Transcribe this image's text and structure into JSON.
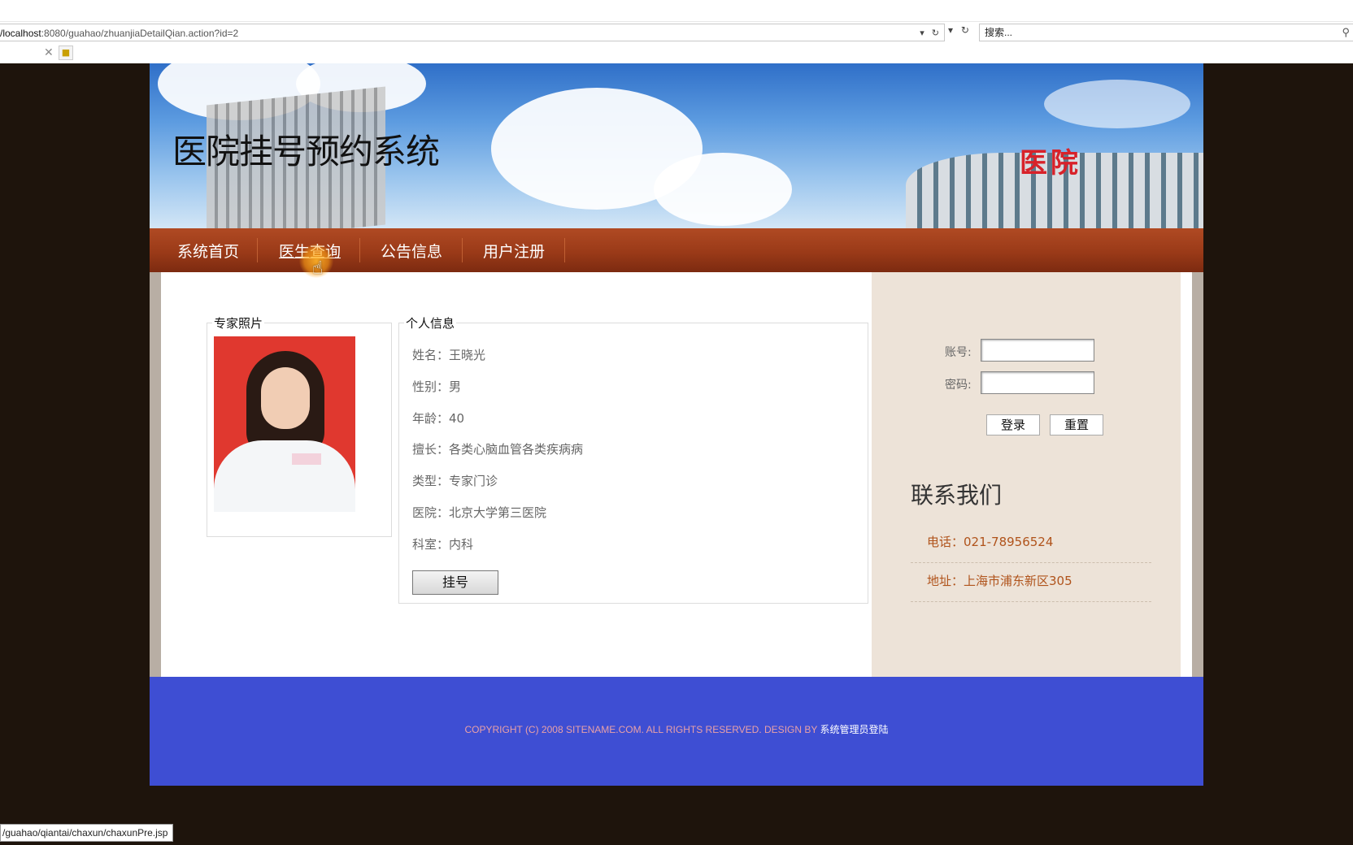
{
  "browser": {
    "address_host": "/localhost",
    "address_rest": ":8080/guahao/zhuanjiaDetailQian.action?id=2",
    "search_placeholder": "搜索...",
    "status_url": "/guahao/qiantai/chaxun/chaxunPre.jsp"
  },
  "site": {
    "title": "医院挂号预约系统",
    "banner_sign": "医院"
  },
  "nav": {
    "items": [
      "系统首页",
      "医生查询",
      "公告信息",
      "用户注册"
    ],
    "active": "医生查询"
  },
  "photo_box": {
    "legend": "专家照片"
  },
  "info_box": {
    "legend": "个人信息",
    "fields": [
      {
        "label": "姓名：",
        "value": "王晓光"
      },
      {
        "label": "性别：",
        "value": "男"
      },
      {
        "label": "年龄：",
        "value": "40"
      },
      {
        "label": "擅长：",
        "value": "各类心脑血管各类疾病病"
      },
      {
        "label": "类型：",
        "value": "专家门诊"
      },
      {
        "label": "医院：",
        "value": "北京大学第三医院"
      },
      {
        "label": "科室：",
        "value": "内科"
      }
    ],
    "register_button": "挂号"
  },
  "login": {
    "account_label": "账号:",
    "password_label": "密码:",
    "login_button": "登录",
    "reset_button": "重置"
  },
  "contact": {
    "title": "联系我们",
    "phone": "电话：021-78956524",
    "address": "地址：上海市浦东新区305"
  },
  "footer": {
    "copyright": "COPYRIGHT (C) 2008 SITENAME.COM. ALL RIGHTS RESERVED. DESIGN BY ",
    "admin_link": "系统管理员登陆"
  },
  "colors": {
    "nav_bar": "#9a3a18",
    "footer": "#3e4ed3",
    "sidebar": "#ede3d8",
    "contact_text": "#b0531b"
  }
}
